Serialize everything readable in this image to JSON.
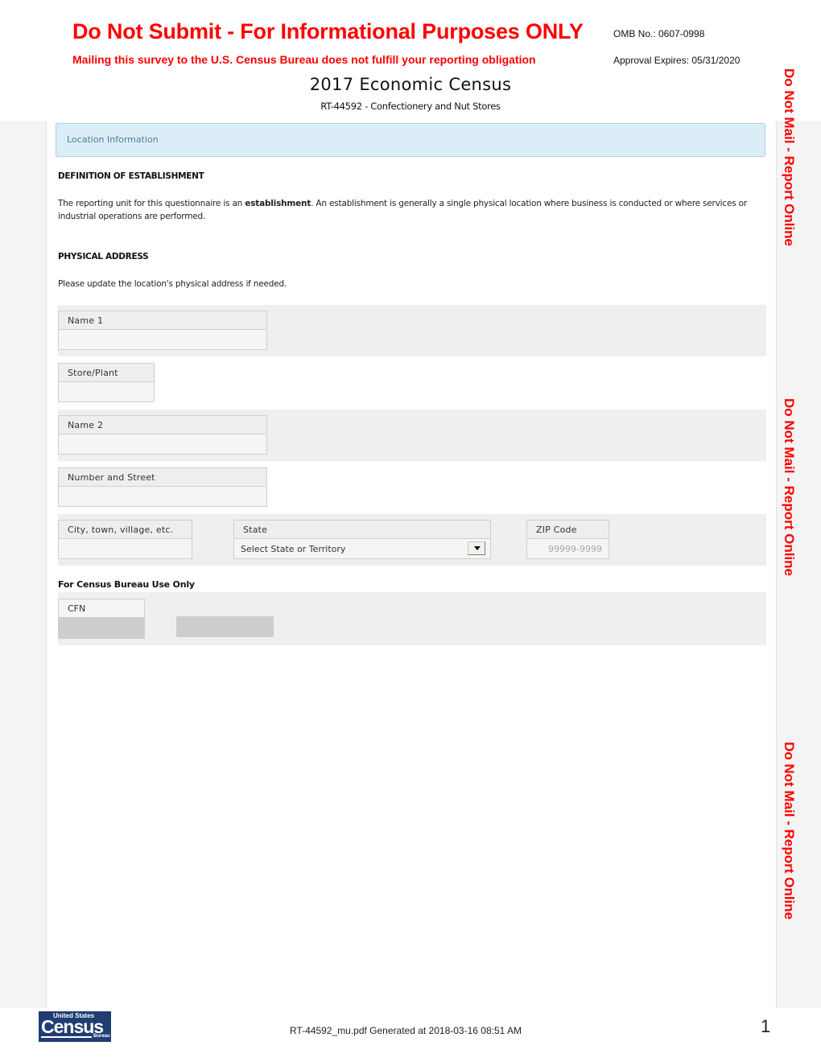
{
  "header": {
    "title": "Do Not Submit - For Informational Purposes ONLY",
    "subtitle": "Mailing this survey to the U.S. Census Bureau does not fulfill your reporting obligation",
    "omb": "OMB No.: 0607-0998",
    "approval": "Approval Expires: 05/31/2020",
    "census_title": "2017 Economic Census",
    "form_subtitle": "RT-44592 - Confectionery and Nut Stores"
  },
  "section_bar": {
    "label": "Location Information"
  },
  "definition": {
    "heading": "DEFINITION OF ESTABLISHMENT",
    "text_before": "The reporting unit for this questionnaire is an ",
    "text_bold": "establishment",
    "text_after": ". An establishment is generally a single physical location where business is conducted or where services or industrial operations are performed."
  },
  "address": {
    "heading": "PHYSICAL ADDRESS",
    "instruction": "Please update the location's physical address if needed.",
    "fields": {
      "name1": {
        "label": "Name 1",
        "value": ""
      },
      "store_plant": {
        "label": "Store/Plant",
        "value": ""
      },
      "name2": {
        "label": "Name 2",
        "value": ""
      },
      "street": {
        "label": "Number and Street",
        "value": ""
      },
      "city": {
        "label": "City, town, village, etc.",
        "value": ""
      },
      "state": {
        "label": "State",
        "selected": "Select State or Territory"
      },
      "zip": {
        "label": "ZIP Code",
        "placeholder": "99999-9999"
      }
    }
  },
  "census_use": {
    "heading": "For Census Bureau Use Only",
    "cfn_label": "CFN",
    "cfn_value": ""
  },
  "side_notice": "Do Not Mail - Report Online",
  "footer": {
    "logo_top": "United States",
    "logo_main": "Census",
    "logo_bottom": "Bureau",
    "generated": "RT-44592_mu.pdf Generated at 2018-03-16 08:51 AM",
    "page_number": "1"
  },
  "colors": {
    "warning_red": "#ff0000",
    "section_bar_bg": "#dbedf7",
    "logo_blue": "#1f3d73"
  }
}
